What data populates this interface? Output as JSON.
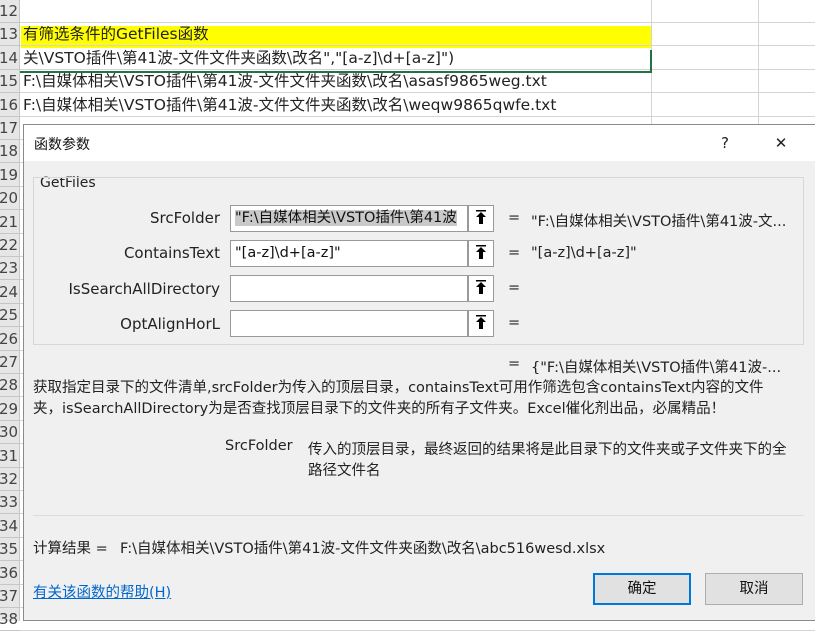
{
  "sheet": {
    "rows": [
      {
        "num": "12",
        "text": ""
      },
      {
        "num": "13",
        "text": "有筛选条件的GetFiles函数"
      },
      {
        "num": "14",
        "text": "关\\VSTO插件\\第41波-文件文件夹函数\\改名\",\"[a-z]\\d+[a-z]\")"
      },
      {
        "num": "15",
        "text": "F:\\自媒体相关\\VSTO插件\\第41波-文件文件夹函数\\改名\\asasf9865weg.txt"
      },
      {
        "num": "16",
        "text": "F:\\自媒体相关\\VSTO插件\\第41波-文件文件夹函数\\改名\\weqw9865qwfe.txt"
      },
      {
        "num": "17",
        "text": ""
      },
      {
        "num": "18",
        "text": ""
      },
      {
        "num": "19",
        "text": ""
      },
      {
        "num": "20",
        "text": ""
      },
      {
        "num": "21",
        "text": ""
      },
      {
        "num": "22",
        "text": ""
      },
      {
        "num": "23",
        "text": ""
      },
      {
        "num": "24",
        "text": ""
      },
      {
        "num": "25",
        "text": ""
      },
      {
        "num": "26",
        "text": ""
      },
      {
        "num": "27",
        "text": ""
      },
      {
        "num": "28",
        "text": ""
      },
      {
        "num": "29",
        "text": ""
      },
      {
        "num": "30",
        "text": ""
      },
      {
        "num": "31",
        "text": ""
      },
      {
        "num": "32",
        "text": ""
      },
      {
        "num": "33",
        "text": ""
      },
      {
        "num": "34",
        "text": ""
      },
      {
        "num": "35",
        "text": ""
      },
      {
        "num": "36",
        "text": ""
      },
      {
        "num": "37",
        "text": ""
      },
      {
        "num": "38",
        "text": ""
      }
    ],
    "highlight_color": "#ffff00"
  },
  "dialog": {
    "title": "函数参数",
    "help_glyph": "?",
    "close_glyph": "✕",
    "function_name": "GetFiles",
    "args": [
      {
        "label": "SrcFolder",
        "value": "\"F:\\自媒体相关\\VSTO插件\\第41波",
        "result": "\"F:\\自媒体相关\\VSTO插件\\第41波-文..."
      },
      {
        "label": "ContainsText",
        "value": "\"[a-z]\\d+[a-z]\"",
        "result": "\"[a-z]\\d+[a-z]\""
      },
      {
        "label": "IsSearchAllDirectory",
        "value": "",
        "result": ""
      },
      {
        "label": "OptAlignHorL",
        "value": "",
        "result": ""
      }
    ],
    "equals": "=",
    "formula_result": "{\"F:\\自媒体相关\\VSTO插件\\第41波-...",
    "description_line1": "获取指定目录下的文件清单,srcFolder为传入的顶层目录，containsText可用作筛选包含containsText内容的文件",
    "description_line2": "夹，isSearchAllDirectory为是否查找顶层目录下的文件夹的所有子文件夹。Excel催化剂出品，必属精品！",
    "param_name": "SrcFolder",
    "param_desc_line1": "传入的顶层目录，最终返回的结果将是此目录下的文件夹或子文件夹下的全",
    "param_desc_line2": "路径文件名",
    "calc_label": "计算结果 =",
    "calc_value": "F:\\自媒体相关\\VSTO插件\\第41波-文件文件夹函数\\改名\\abc516wesd.xlsx",
    "help_link": "有关该函数的帮助(H)",
    "ok_label": "确定",
    "cancel_label": "取消",
    "accent_color": "#0078d7"
  }
}
